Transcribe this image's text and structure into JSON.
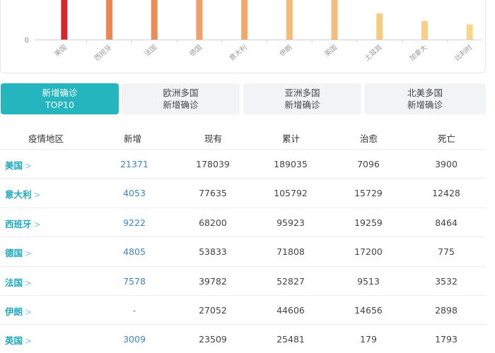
{
  "chart_data": {
    "type": "bar",
    "categories": [
      "美国",
      "西班牙",
      "法国",
      "德国",
      "意大利",
      "伊朗",
      "英国",
      "土耳其",
      "加拿大",
      "比利时"
    ],
    "values": [
      21371,
      9222,
      7578,
      4805,
      4053,
      2980,
      3009,
      1610,
      1150,
      930
    ],
    "y_tick_labels": [
      "0"
    ],
    "ylim": [
      0,
      4200
    ],
    "colors": [
      "#d8262a",
      "#ec8655",
      "#ee8c58",
      "#f2a066",
      "#f3a86b",
      "#f5bb75",
      "#f5bd77",
      "#f8cb80",
      "#f9cf84",
      "#fad688"
    ]
  },
  "tabs": [
    {
      "line1": "新增确诊",
      "line2": "TOP10",
      "active": true
    },
    {
      "line1": "欧洲多国",
      "line2": "新增确诊",
      "active": false
    },
    {
      "line1": "亚洲多国",
      "line2": "新增确诊",
      "active": false
    },
    {
      "line1": "北美多国",
      "line2": "新增确诊",
      "active": false
    }
  ],
  "table": {
    "headers": [
      "疫情地区",
      "新增",
      "现有",
      "累计",
      "治愈",
      "死亡"
    ],
    "chevron": ">",
    "rows": [
      {
        "region": "美国",
        "new": "21371",
        "current": "178039",
        "total": "189035",
        "cured": "7096",
        "deaths": "3900"
      },
      {
        "region": "意大利",
        "new": "4053",
        "current": "77635",
        "total": "105792",
        "cured": "15729",
        "deaths": "12428"
      },
      {
        "region": "西班牙",
        "new": "9222",
        "current": "68200",
        "total": "95923",
        "cured": "19259",
        "deaths": "8464"
      },
      {
        "region": "德国",
        "new": "4805",
        "current": "53833",
        "total": "71808",
        "cured": "17200",
        "deaths": "775"
      },
      {
        "region": "法国",
        "new": "7578",
        "current": "39782",
        "total": "52827",
        "cured": "9513",
        "deaths": "3532"
      },
      {
        "region": "伊朗",
        "new": "-",
        "current": "27052",
        "total": "44606",
        "cured": "14656",
        "deaths": "2898"
      },
      {
        "region": "英国",
        "new": "3009",
        "current": "23509",
        "total": "25481",
        "cured": "179",
        "deaths": "1793"
      }
    ]
  }
}
